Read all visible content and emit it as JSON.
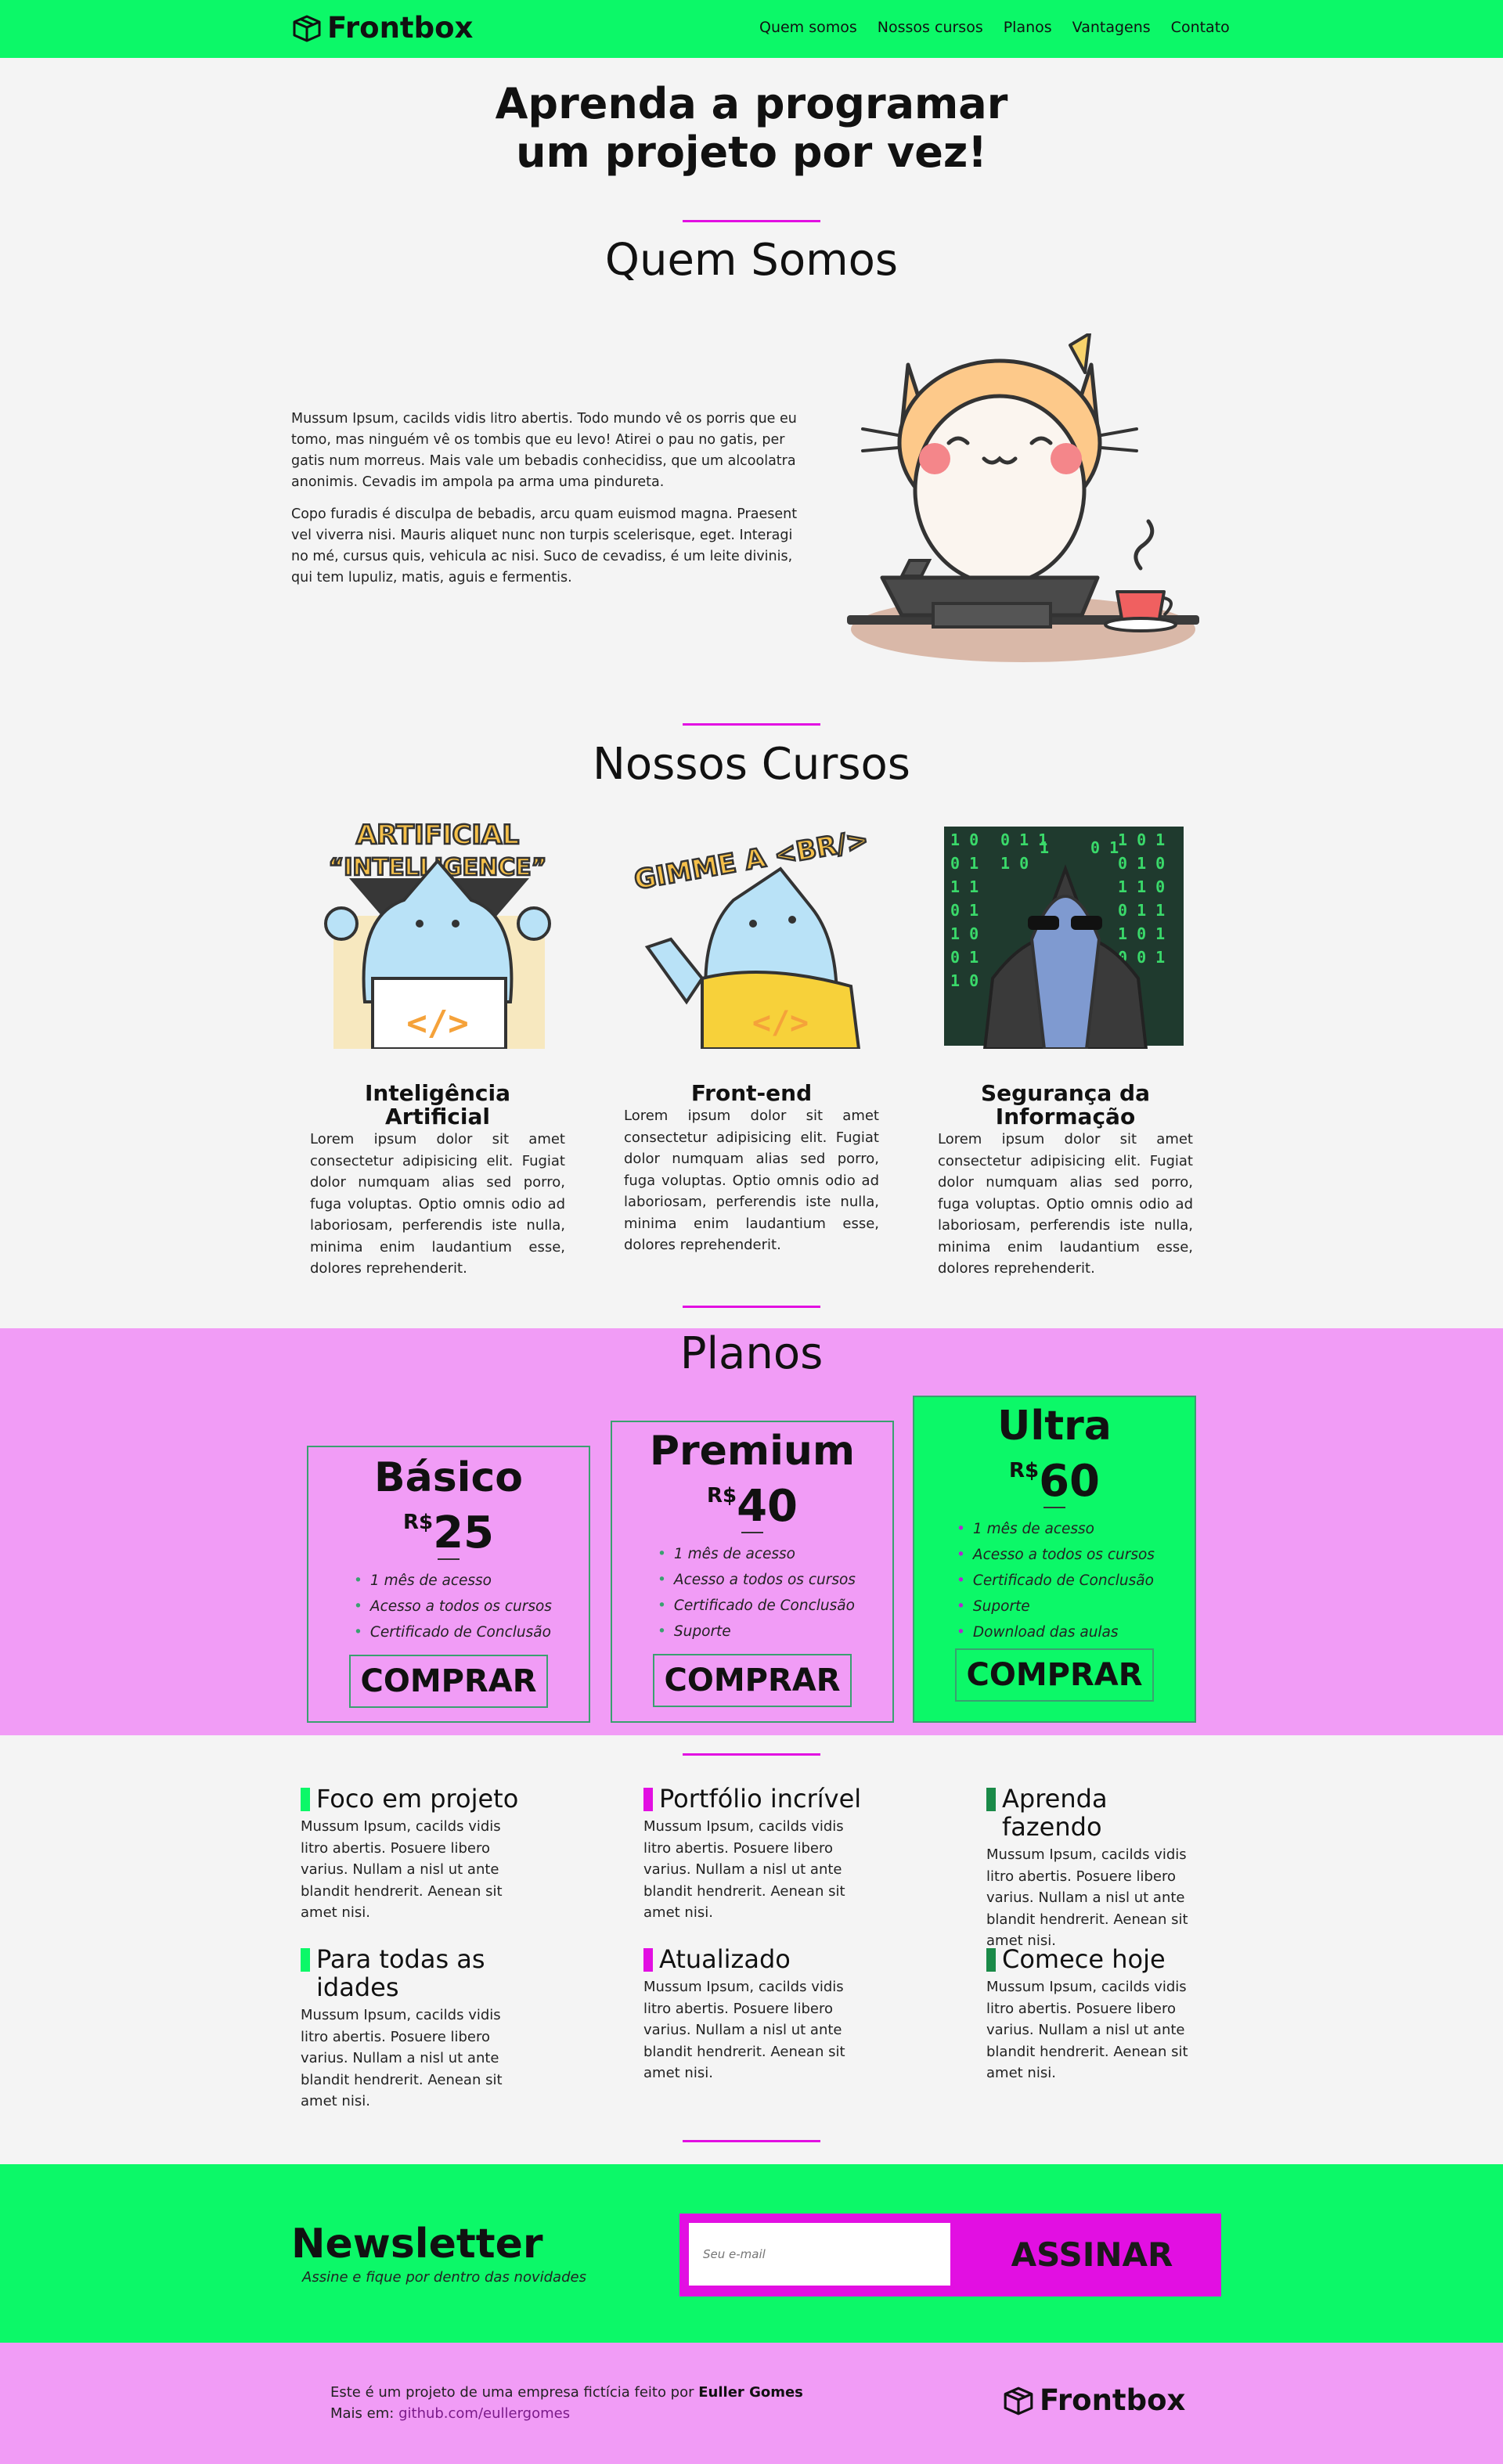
{
  "colors": {
    "brand_green": "#0cf868",
    "brand_pink": "#f19cf6",
    "accent_magenta": "#e20fe2",
    "dark_green": "#3aa070"
  },
  "header": {
    "logo": "Frontbox",
    "logo_icon": "box-icon",
    "nav": [
      "Quem somos",
      "Nossos cursos",
      "Planos",
      "Vantagens",
      "Contato"
    ]
  },
  "hero": {
    "title_line1": "Aprenda a programar",
    "title_line2": "um projeto por vez!"
  },
  "about": {
    "title": "Quem Somos",
    "paragraph1": "Mussum Ipsum, cacilds vidis litro abertis. Todo mundo vê os porris que eu tomo, mas ninguém vê os tombis que eu levo! Atirei o pau no gatis, per gatis num morreus. Mais vale um bebadis conhecidiss, que um alcoolatra anonimis. Cevadis im ampola pa arma uma pindureta.",
    "paragraph2": "Copo furadis é disculpa de bebadis, arcu quam euismod magna. Praesent vel viverra nisi. Mauris aliquet nunc non turpis scelerisque, eget. Interagi no mé, cursus quis, vehicula ac nisi. Suco de cevadiss, é um leite divinis, qui tem lupuliz, matis, aguis e fermentis."
  },
  "courses": {
    "title": "Nossos Cursos",
    "items": [
      {
        "name": "Inteligência Artificial",
        "image_text_line1": "ARTIFICIAL",
        "image_text_line2": "“INTELLIGENCE”",
        "description": "Lorem ipsum dolor sit amet consectetur adipisicing elit. Fugiat dolor numquam alias sed porro, fuga voluptas. Optio omnis odio ad laboriosam, perferendis iste nulla, minima enim laudantium esse, dolores reprehenderit."
      },
      {
        "name": "Front-end",
        "image_text": "GIMME A <BR/>",
        "description": "Lorem ipsum dolor sit amet consectetur adipisicing elit. Fugiat dolor numquam alias sed porro, fuga voluptas. Optio omnis odio ad laboriosam, perferendis iste nulla, minima enim laudantium esse, dolores reprehenderit."
      },
      {
        "name_line1": "Segurança da",
        "name_line2": "Informação",
        "description": "Lorem ipsum dolor sit amet consectetur adipisicing elit. Fugiat dolor numquam alias sed porro, fuga voluptas. Optio omnis odio ad laboriosam, perferendis iste nulla, minima enim laudantium esse, dolores reprehenderit."
      }
    ]
  },
  "plans": {
    "title": "Planos",
    "currency": "R$",
    "buy_label": "COMPRAR",
    "items": [
      {
        "name": "Básico",
        "price": "25",
        "features": [
          "1 mês de acesso",
          "Acesso a todos os cursos",
          "Certificado de Conclusão"
        ]
      },
      {
        "name": "Premium",
        "price": "40",
        "features": [
          "1 mês de acesso",
          "Acesso a todos os cursos",
          "Certificado de Conclusão",
          "Suporte"
        ]
      },
      {
        "name": "Ultra",
        "price": "60",
        "features": [
          "1 mês de acesso",
          "Acesso a todos os cursos",
          "Certificado de Conclusão",
          "Suporte",
          "Download das aulas"
        ]
      }
    ]
  },
  "advantages": {
    "items": [
      {
        "title": "Foco em projeto",
        "color": "#0cf868",
        "text": "Mussum Ipsum, cacilds vidis litro abertis. Posuere libero varius. Nullam a nisl ut ante blandit hendrerit. Aenean sit amet nisi."
      },
      {
        "title": "Portfólio incrível",
        "color": "#e20fe2",
        "text": "Mussum Ipsum, cacilds vidis litro abertis. Posuere libero varius. Nullam a nisl ut ante blandit hendrerit. Aenean sit amet nisi."
      },
      {
        "title": "Aprenda fazendo",
        "color": "#1a8a48",
        "text": "Mussum Ipsum, cacilds vidis litro abertis. Posuere libero varius. Nullam a nisl ut ante blandit hendrerit. Aenean sit amet nisi."
      },
      {
        "title": "Para todas as idades",
        "color": "#0cf868",
        "text": "Mussum Ipsum, cacilds vidis litro abertis. Posuere libero varius. Nullam a nisl ut ante blandit hendrerit. Aenean sit amet nisi."
      },
      {
        "title": "Atualizado",
        "color": "#e20fe2",
        "text": "Mussum Ipsum, cacilds vidis litro abertis. Posuere libero varius. Nullam a nisl ut ante blandit hendrerit. Aenean sit amet nisi."
      },
      {
        "title": "Comece hoje",
        "color": "#1a8a48",
        "text": "Mussum Ipsum, cacilds vidis litro abertis. Posuere libero varius. Nullam a nisl ut ante blandit hendrerit. Aenean sit amet nisi."
      }
    ]
  },
  "newsletter": {
    "title": "Newsletter",
    "subtitle": "Assine e fique por dentro das novidades",
    "email_placeholder": "Seu e-mail",
    "submit_label": "ASSINAR"
  },
  "footer": {
    "text_prefix": "Este é um projeto de uma empresa fictícia feito por",
    "author": "Euller Gomes",
    "more_prefix": "Mais em:",
    "link": "github.com/eullergomes",
    "logo": "Frontbox"
  }
}
